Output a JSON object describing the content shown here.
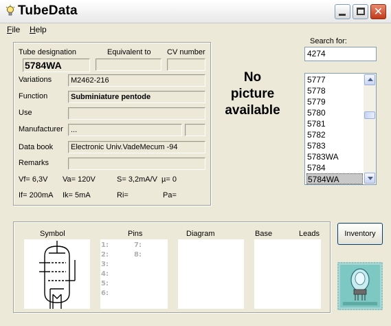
{
  "window": {
    "title": "TubeData"
  },
  "menu": [
    "File",
    "Help"
  ],
  "fields": {
    "tube_designation": {
      "label": "Tube designation",
      "value": "5784WA"
    },
    "equivalent_to": {
      "label": "Equivalent to",
      "value": ""
    },
    "cv_number": {
      "label": "CV number",
      "value": ""
    },
    "variations": {
      "label": "Variations",
      "value": "M2462-216"
    },
    "function": {
      "label": "Function",
      "value": "Subminiature pentode"
    },
    "use": {
      "label": "Use",
      "value": ""
    },
    "manufacturer": {
      "label": "Manufacturer",
      "value": "..."
    },
    "data_book": {
      "label": "Data book",
      "value": "Electronic Univ.VadeMecum -94"
    },
    "remarks": {
      "label": "Remarks",
      "value": ""
    }
  },
  "params": {
    "vf": "Vf= 6,3V",
    "va": "Va= 120V",
    "s": "S= 3,2mA/V",
    "mu": "µ=   0",
    "if": "If= 200mA",
    "ik": "Ik=   5mA",
    "ri": "Ri=",
    "pa": "Pa="
  },
  "no_picture": [
    "No",
    "picture",
    "available"
  ],
  "search": {
    "label": "Search for:",
    "value": "4274"
  },
  "list": {
    "items": [
      "5777",
      "5778",
      "5779",
      "5780",
      "5781",
      "5782",
      "5783",
      "5783WA",
      "5784",
      "5784WA"
    ],
    "selected": "5784WA"
  },
  "bottom": {
    "headers": {
      "symbol": "Symbol",
      "pins": "Pins",
      "diagram": "Diagram",
      "base": "Base",
      "leads": "Leads"
    },
    "pins_left": [
      "1:",
      "2:",
      "3:",
      "4:",
      "5:",
      "6:"
    ],
    "pins_right": [
      "7:",
      "8:"
    ]
  },
  "inventory_button": "Inventory",
  "colors": {
    "window_bg": "#ece9d8",
    "close_btn": "#c2391c",
    "selection": "#c8c8c8"
  }
}
